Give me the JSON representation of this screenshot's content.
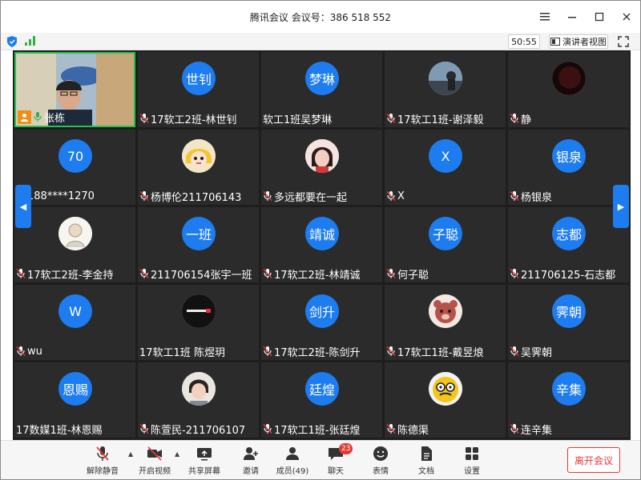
{
  "window": {
    "title": "腾讯会议 会议号：386 518 552",
    "controls": [
      "menu-icon",
      "minimize-icon",
      "maximize-icon",
      "close-icon"
    ]
  },
  "subbar": {
    "timer": "50:55",
    "speaker_view_label": "演讲者视图"
  },
  "participants": [
    {
      "name": "张栋",
      "kind": "camera",
      "muted": false,
      "host": true
    },
    {
      "name": "17软工2班-林世钊",
      "avatar_text": "世钊",
      "muted": true
    },
    {
      "name": "软工1班吴梦琳",
      "avatar_text": "梦琳",
      "muted": false
    },
    {
      "name": "17软工1班-谢泽毅",
      "avatar_kind": "photo-landscape",
      "muted": true
    },
    {
      "name": "静",
      "avatar_kind": "photo-dark",
      "muted": true
    },
    {
      "name": "188****1270",
      "avatar_text": "70",
      "muted": true
    },
    {
      "name": "杨博伦211706143",
      "avatar_kind": "cartoon-girl",
      "muted": true
    },
    {
      "name": "多远都要在一起",
      "avatar_kind": "photo-portrait",
      "muted": true
    },
    {
      "name": "X",
      "avatar_text": "X",
      "muted": true
    },
    {
      "name": "杨银泉",
      "avatar_text": "银泉",
      "muted": true
    },
    {
      "name": "17软工2班-李金持",
      "avatar_kind": "sketch",
      "muted": true
    },
    {
      "name": "211706154张宇一班",
      "avatar_text": "一班",
      "muted": true
    },
    {
      "name": "17软工2班-林靖诚",
      "avatar_text": "靖诚",
      "muted": true
    },
    {
      "name": "何子聪",
      "avatar_text": "子聪",
      "muted": true
    },
    {
      "name": "211706125-石志都",
      "avatar_text": "志都",
      "muted": true
    },
    {
      "name": "wu",
      "avatar_text": "W",
      "muted": true
    },
    {
      "name": "17软工1班 陈煜玥",
      "avatar_kind": "logo-dark",
      "muted": false
    },
    {
      "name": "17软工2班-陈剑升",
      "avatar_text": "剑升",
      "muted": true
    },
    {
      "name": "17软工1班-戴昱烺",
      "avatar_kind": "cartoon-bear",
      "muted": true
    },
    {
      "name": "吴霁朝",
      "avatar_text": "霁朝",
      "muted": true
    },
    {
      "name": "17数媒1班-林恩赐",
      "avatar_text": "恩赐",
      "muted": false
    },
    {
      "name": "陈萱民-211706107",
      "avatar_kind": "photo-face",
      "muted": true
    },
    {
      "name": "17软工1班-张廷煌",
      "avatar_text": "廷煌",
      "muted": true
    },
    {
      "name": "陈德渠",
      "avatar_kind": "cartoon-glasses",
      "muted": true
    },
    {
      "name": "连辛集",
      "avatar_text": "辛集",
      "muted": true
    }
  ],
  "toolbar": {
    "unmute": "解除静音",
    "start_video": "开启视频",
    "share_screen": "共享屏幕",
    "invite": "邀请",
    "members": "成员(49)",
    "chat": "聊天",
    "chat_badge": "23",
    "reactions": "表情",
    "docs": "文档",
    "settings": "设置",
    "leave": "离开会议"
  },
  "colors": {
    "accent": "#1c7cf0",
    "leave": "#e53935",
    "active_speaker": "#27c24c"
  }
}
